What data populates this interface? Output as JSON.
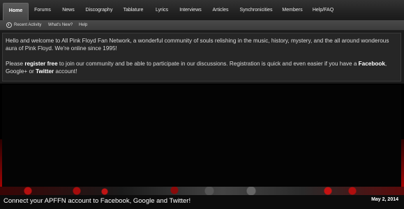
{
  "nav": {
    "tabs": [
      {
        "label": "Home",
        "active": true
      },
      {
        "label": "Forums"
      },
      {
        "label": "News"
      },
      {
        "label": "Discography"
      },
      {
        "label": "Tablature"
      },
      {
        "label": "Lyrics"
      },
      {
        "label": "Interviews"
      },
      {
        "label": "Articles"
      },
      {
        "label": "Synchronicities"
      },
      {
        "label": "Members"
      },
      {
        "label": "Help/FAQ"
      }
    ]
  },
  "subnav": {
    "items": [
      {
        "label": "Recent Activity",
        "icon": "clock-icon"
      },
      {
        "label": "What's New?"
      },
      {
        "label": "Help"
      }
    ]
  },
  "welcome": {
    "line1": "Hello and welcome to All Pink Floyd Fan Network, a wonderful community of souls relishing in the music, history, mystery, and the all around wonderous aura of Pink Floyd. We're online since 1995!",
    "p2_prefix": "Please ",
    "p2_register": "register free",
    "p2_mid": " to join our community and be able to participate in our discussions. Registration is quick and even easier if you have a ",
    "p2_facebook": "Facebook",
    "p2_google": ", Google+ or ",
    "p2_twitter": "Twitter",
    "p2_suffix": " account!"
  },
  "banner": {
    "caption": "Connect your APFFN account to Facebook, Google and Twitter!",
    "date": "May 2, 2014"
  }
}
